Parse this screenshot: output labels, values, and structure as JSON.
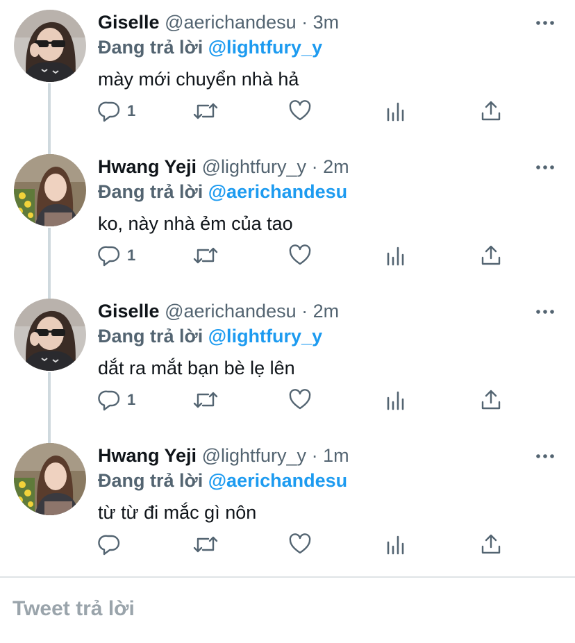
{
  "thread": {
    "replying_label": "Đang trả lời",
    "tweets": [
      {
        "author": "Giselle",
        "handle": "@aerichandesu",
        "separator": "·",
        "time": "3m",
        "reply_to": "@lightfury_y",
        "text": "mày mới chuyển nhà hả",
        "reply_count": "1"
      },
      {
        "author": "Hwang Yeji",
        "handle": "@lightfury_y",
        "separator": "·",
        "time": "2m",
        "reply_to": "@aerichandesu",
        "text": "ko, này nhà ẻm của tao",
        "reply_count": "1"
      },
      {
        "author": "Giselle",
        "handle": "@aerichandesu",
        "separator": "·",
        "time": "2m",
        "reply_to": "@lightfury_y",
        "text": "dắt ra mắt bạn bè lẹ lên",
        "reply_count": "1"
      },
      {
        "author": "Hwang Yeji",
        "handle": "@lightfury_y",
        "separator": "·",
        "time": "1m",
        "reply_to": "@aerichandesu",
        "text": "từ từ đi mắc gì nôn",
        "reply_count": ""
      }
    ]
  },
  "reply_box": {
    "placeholder": "Tweet trả lời"
  },
  "colors": {
    "mention": "#1d9bf0",
    "secondary_text": "#536471",
    "thread_line": "#cfd9de"
  },
  "icons": [
    "more-icon",
    "reply-icon",
    "retweet-icon",
    "like-icon",
    "analytics-icon",
    "share-icon"
  ]
}
